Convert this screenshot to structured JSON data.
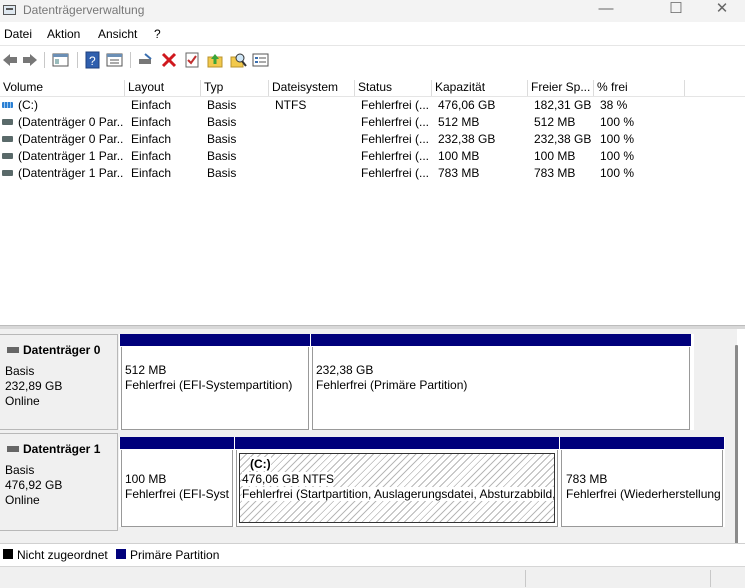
{
  "window": {
    "title": "Datenträgerverwaltung",
    "minimize": "—",
    "maximize": "☐",
    "close": "✕"
  },
  "menu": [
    "Datei",
    "Aktion",
    "Ansicht",
    "?"
  ],
  "toolbar": {
    "icons": [
      "back-icon",
      "forward-icon",
      "console-tree-icon",
      "help-icon",
      "properties-icon",
      "connect-disk-icon",
      "delete-icon",
      "check-icon",
      "up-folder-icon",
      "search-icon",
      "list-view-icon"
    ]
  },
  "columns": [
    "Volume",
    "Layout",
    "Typ",
    "Dateisystem",
    "Status",
    "Kapazität",
    "Freier Sp...",
    "% frei"
  ],
  "rows": [
    {
      "volume": "(C:)",
      "layout": "Einfach",
      "typ": "Basis",
      "fs": "NTFS",
      "status": "Fehlerfrei (...",
      "kap": "476,06 GB",
      "frei": "182,31 GB",
      "pct": "38 %"
    },
    {
      "volume": "(Datenträger 0 Par...",
      "layout": "Einfach",
      "typ": "Basis",
      "fs": "",
      "status": "Fehlerfrei (...",
      "kap": "512 MB",
      "frei": "512 MB",
      "pct": "100 %"
    },
    {
      "volume": "(Datenträger 0 Par...",
      "layout": "Einfach",
      "typ": "Basis",
      "fs": "",
      "status": "Fehlerfrei (...",
      "kap": "232,38 GB",
      "frei": "232,38 GB",
      "pct": "100 %"
    },
    {
      "volume": "(Datenträger 1 Par...",
      "layout": "Einfach",
      "typ": "Basis",
      "fs": "",
      "status": "Fehlerfrei (...",
      "kap": "100 MB",
      "frei": "100 MB",
      "pct": "100 %"
    },
    {
      "volume": "(Datenträger 1 Par...",
      "layout": "Einfach",
      "typ": "Basis",
      "fs": "",
      "status": "Fehlerfrei (...",
      "kap": "783 MB",
      "frei": "783 MB",
      "pct": "100 %"
    }
  ],
  "disks": [
    {
      "name": "Datenträger 0",
      "type": "Basis",
      "size": "232,89 GB",
      "state": "Online",
      "partitions": [
        {
          "label": "",
          "size": "512 MB",
          "status": "Fehlerfrei (EFI-Systempartition)"
        },
        {
          "label": "",
          "size": "232,38 GB",
          "status": "Fehlerfrei (Primäre Partition)"
        }
      ]
    },
    {
      "name": "Datenträger 1",
      "type": "Basis",
      "size": "476,92 GB",
      "state": "Online",
      "partitions": [
        {
          "label": "",
          "size": "100 MB",
          "status": "Fehlerfrei (EFI-Syst"
        },
        {
          "label": "(C:)",
          "size": "476,06 GB NTFS",
          "status": "Fehlerfrei (Startpartition, Auslagerungsdatei, Absturzabbild,"
        },
        {
          "label": "",
          "size": "783 MB",
          "status": "Fehlerfrei (Wiederherstellung"
        }
      ]
    }
  ],
  "legend": [
    {
      "label": "Nicht zugeordnet",
      "color": "#000000"
    },
    {
      "label": "Primäre Partition",
      "color": "#00007b"
    }
  ]
}
